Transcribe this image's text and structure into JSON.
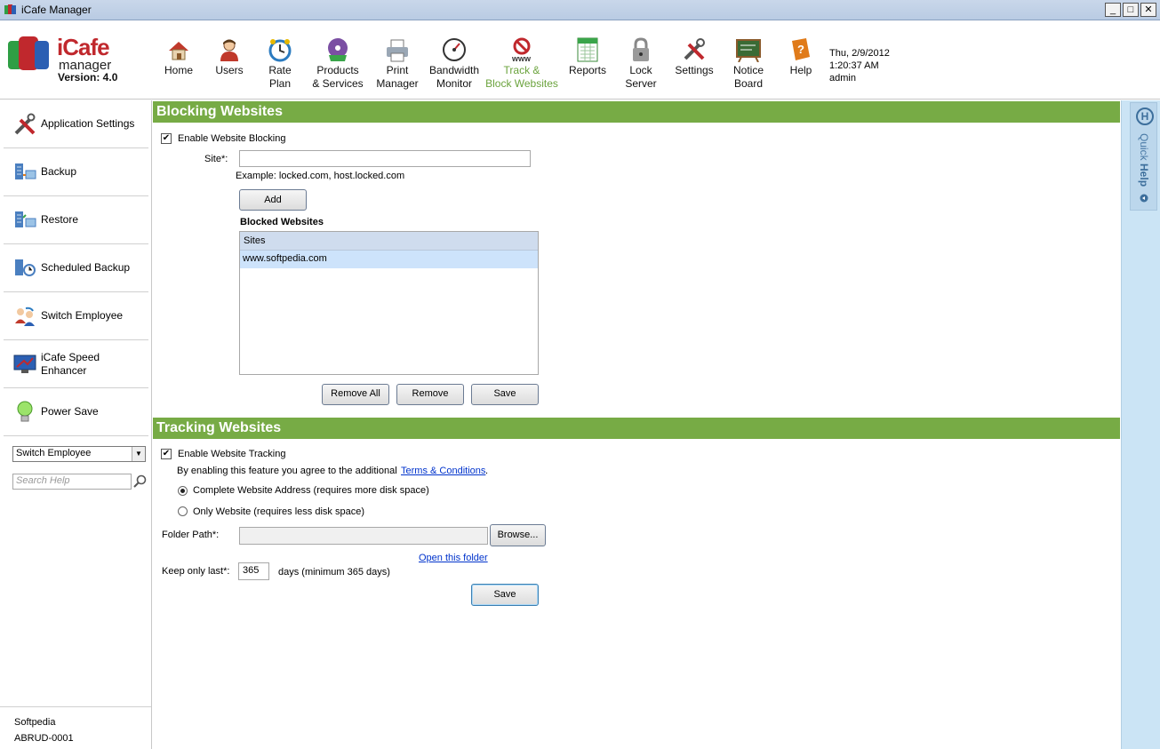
{
  "window": {
    "title": "iCafe Manager",
    "controls": [
      "minimize",
      "maximize",
      "close"
    ]
  },
  "logo": {
    "brand": "iCafe",
    "sub": "manager",
    "version": "Version: 4.0"
  },
  "toolbar": [
    {
      "label": "Home",
      "icon": "home-icon"
    },
    {
      "label": "Users",
      "icon": "users-icon"
    },
    {
      "label": "Rate\nPlan",
      "icon": "rate-plan-icon"
    },
    {
      "label": "Products\n& Services",
      "icon": "products-icon"
    },
    {
      "label": "Print\nManager",
      "icon": "printer-icon"
    },
    {
      "label": "Bandwidth\nMonitor",
      "icon": "bandwidth-gauge-icon"
    },
    {
      "label": "Track &\nBlock Websites",
      "icon": "block-websites-icon",
      "active": true
    },
    {
      "label": "Reports",
      "icon": "reports-icon"
    },
    {
      "label": "Lock\nServer",
      "icon": "lock-icon"
    },
    {
      "label": "Settings",
      "icon": "settings-tools-icon"
    },
    {
      "label": "Notice\nBoard",
      "icon": "notice-board-icon"
    },
    {
      "label": "Help",
      "icon": "help-book-icon"
    }
  ],
  "status": {
    "date": "Thu, 2/9/2012",
    "time": "1:20:37 AM",
    "user": "admin"
  },
  "sidebar": {
    "items": [
      {
        "label": "Application Settings",
        "icon": "app-settings-icon"
      },
      {
        "label": "Backup",
        "icon": "backup-icon"
      },
      {
        "label": "Restore",
        "icon": "restore-icon"
      },
      {
        "label": "Scheduled Backup",
        "icon": "scheduled-backup-icon"
      },
      {
        "label": "Switch Employee",
        "icon": "switch-employee-icon"
      },
      {
        "label": "iCafe Speed\nEnhancer",
        "icon": "speed-enhancer-icon"
      },
      {
        "label": "Power Save",
        "icon": "lightbulb-icon"
      }
    ],
    "dropdown_value": "Switch Employee",
    "search_placeholder": "Search Help",
    "footer": {
      "line1": "Softpedia",
      "line2": "ABRUD-0001"
    }
  },
  "blocking": {
    "title": "Blocking Websites",
    "enable_label": "Enable Website Blocking",
    "enable_checked": true,
    "site_label": "Site*:",
    "site_value": "",
    "example": "Example: locked.com, host.locked.com",
    "add_label": "Add",
    "list_title": "Blocked Websites",
    "list_header": "Sites",
    "sites": [
      "www.softpedia.com"
    ],
    "remove_all_label": "Remove All",
    "remove_label": "Remove",
    "save_label": "Save"
  },
  "tracking": {
    "title": "Tracking Websites",
    "enable_label": "Enable Website Tracking",
    "enable_checked": true,
    "agree_text": "By enabling this feature you agree to the additional",
    "terms_link": "Terms & Conditions",
    "agree_suffix": ".",
    "option_complete": "Complete Website Address (requires more disk space)",
    "option_only": "Only Website (requires less disk space)",
    "selected_option": "complete",
    "folder_label": "Folder Path*:",
    "folder_value": "",
    "browse_label": "Browse...",
    "open_folder_link": "Open this folder",
    "keep_label": "Keep only last*:",
    "keep_value": "365",
    "keep_suffix": "days (minimum 365 days)",
    "save_label": "Save"
  },
  "quick_help": {
    "label_a": "Quick ",
    "label_b": "Help",
    "badge": "H"
  },
  "colors": {
    "section_header": "#77ab45",
    "active_tool": "#6ba33d",
    "selection": "#cde3fb",
    "quick_help_bg": "#cbe4f5",
    "link": "#0033cc"
  }
}
